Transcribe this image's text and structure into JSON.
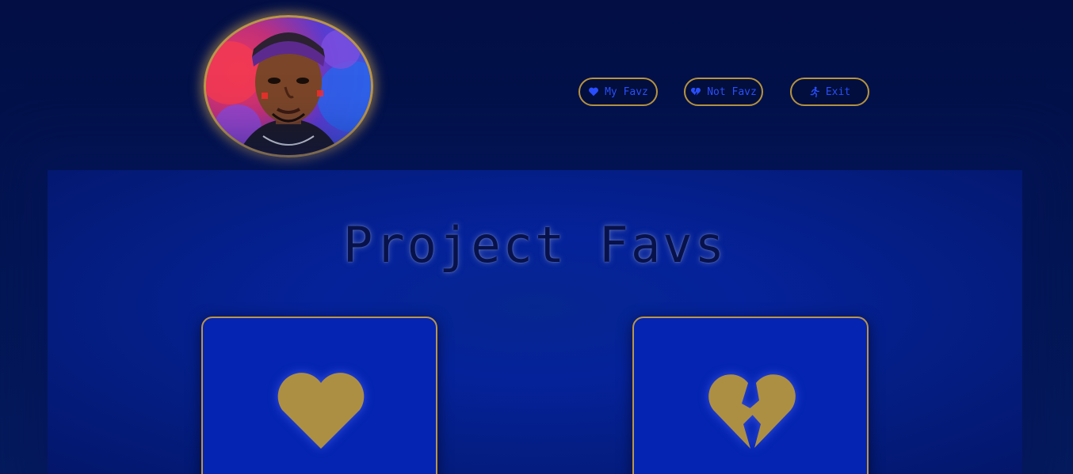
{
  "header": {
    "avatar_alt": "profile avatar",
    "nav": [
      {
        "label": "My Favz",
        "icon": "heart-icon"
      },
      {
        "label": "Not Favz",
        "icon": "broken-heart-icon"
      },
      {
        "label": "Exit",
        "icon": "running-person-icon"
      }
    ]
  },
  "main": {
    "title": "Project Favs",
    "cards": [
      {
        "icon": "heart-icon"
      },
      {
        "icon": "broken-heart-icon"
      }
    ]
  },
  "colors": {
    "background": "#020e44",
    "panel": "#05229a",
    "card": "#0424b1",
    "gold": "#b9954a",
    "icon_gold": "#ad8f44",
    "button_text": "#2a4fff",
    "title_text": "#08124a"
  }
}
